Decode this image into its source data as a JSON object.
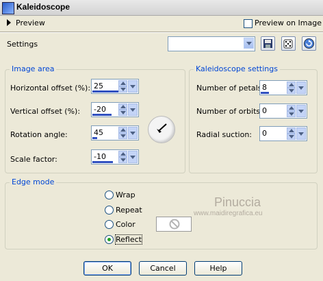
{
  "window": {
    "title": "Kaleidoscope"
  },
  "preview": {
    "label": "Preview",
    "preview_on_image_label": "Preview on Image",
    "preview_on_image_checked": false
  },
  "settings": {
    "label": "Settings",
    "selected_value": ""
  },
  "image_area": {
    "title": "Image area",
    "horizontal_offset": {
      "label": "Horizontal offset (%):",
      "value": "25"
    },
    "vertical_offset": {
      "label": "Vertical offset (%):",
      "value": "-20"
    },
    "rotation_angle": {
      "label": "Rotation angle:",
      "value": "45"
    },
    "scale_factor": {
      "label": "Scale factor:",
      "value": "-10"
    }
  },
  "kaleidoscope_settings": {
    "title": "Kaleidoscope settings",
    "number_of_petals": {
      "label": "Number of petals:",
      "value": "8"
    },
    "number_of_orbits": {
      "label": "Number of orbits:",
      "value": "0"
    },
    "radial_suction": {
      "label": "Radial suction:",
      "value": "0"
    }
  },
  "edge_mode": {
    "title": "Edge mode",
    "options": [
      "Wrap",
      "Repeat",
      "Color",
      "Reflect"
    ],
    "selected": "Reflect"
  },
  "watermark": {
    "line1": "Pinuccia",
    "line2": "www.maidiregrafica.eu"
  },
  "buttons": {
    "ok": "OK",
    "cancel": "Cancel",
    "help": "Help"
  },
  "colors": {
    "group_title": "#0046d5",
    "spin_bar": "#3050c0",
    "dialog_bg": "#ece9d8"
  },
  "icons": [
    "save-icon",
    "dice-icon",
    "reset-icon",
    "no-color-icon",
    "dial-arrow-icon"
  ]
}
